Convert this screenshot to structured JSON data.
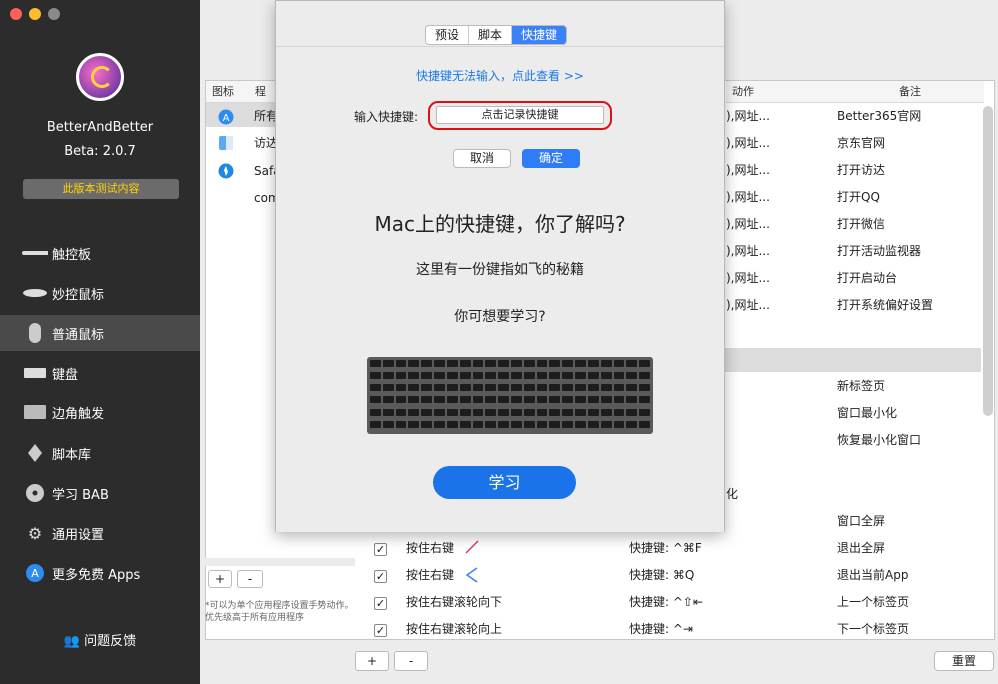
{
  "sidebar": {
    "app_name": "BetterAndBetter",
    "version": "Beta: 2.0.7",
    "beta_button": "此版本测试内容",
    "items": [
      {
        "label": "触控板"
      },
      {
        "label": "妙控鼠标"
      },
      {
        "label": "普通鼠标"
      },
      {
        "label": "键盘"
      },
      {
        "label": "边角触发"
      },
      {
        "label": "脚本库"
      },
      {
        "label": "学习 BAB"
      },
      {
        "label": "通用设置"
      },
      {
        "label": "更多免费 Apps"
      }
    ],
    "feedback": "问题反馈"
  },
  "table": {
    "col_icon": "图标",
    "col_program": "程序",
    "col_action": "动作",
    "col_note": "备注",
    "apps": [
      "所有",
      "访达",
      "Safa",
      "com"
    ],
    "actions": [
      {
        "action": "),网址...",
        "note": "Better365官网"
      },
      {
        "action": "),网址...",
        "note": "京东官网"
      },
      {
        "action": "),网址...",
        "note": "打开访达"
      },
      {
        "action": "),网址...",
        "note": "打开QQ"
      },
      {
        "action": "),网址...",
        "note": "打开微信"
      },
      {
        "action": "),网址...",
        "note": "打开活动监视器"
      },
      {
        "action": "),网址...",
        "note": "打开启动台"
      },
      {
        "action": "),网址...",
        "note": "打开系统偏好设置"
      }
    ],
    "notes2": [
      "新标签页",
      "窗口最小化",
      "恢复最小化窗口"
    ],
    "partial_text": "化",
    "note_fullscreen": "窗口全屏",
    "bottom_rows": [
      {
        "gesture": "按住右键",
        "action": "快捷键: ^⌘F",
        "note": "退出全屏"
      },
      {
        "gesture": "按住右键",
        "action": "快捷键: ⌘Q",
        "note": "退出当前App"
      },
      {
        "gesture": "按住右键滚轮向下",
        "action": "快捷键: ^⇧⇤",
        "note": "上一个标签页"
      },
      {
        "gesture": "按住右键滚轮向上",
        "action": "快捷键: ^⇥",
        "note": "下一个标签页"
      }
    ],
    "plus": "+",
    "minus": "-",
    "note": "*可以为单个应用程序设置手势动作。优先级高于所有应用程序",
    "reset": "重置"
  },
  "dialog": {
    "tabs": [
      {
        "label": "预设"
      },
      {
        "label": "脚本"
      },
      {
        "label": "快捷键"
      }
    ],
    "selected_tab": "快捷键",
    "link": "快捷键无法输入，点此查看 >>",
    "shortcut_label": "输入快捷键:",
    "shortcut_field": "点击记录快捷键",
    "cancel": "取消",
    "ok": "确定",
    "title": "Mac上的快捷键，你了解吗?",
    "subtitle": "这里有一份键指如飞的秘籍",
    "question": "你可想要学习?",
    "learn": "学习"
  },
  "colors": {
    "accent": "#1a73e8",
    "sidebar": "#2c2c2c",
    "highlight": "#e01010"
  }
}
